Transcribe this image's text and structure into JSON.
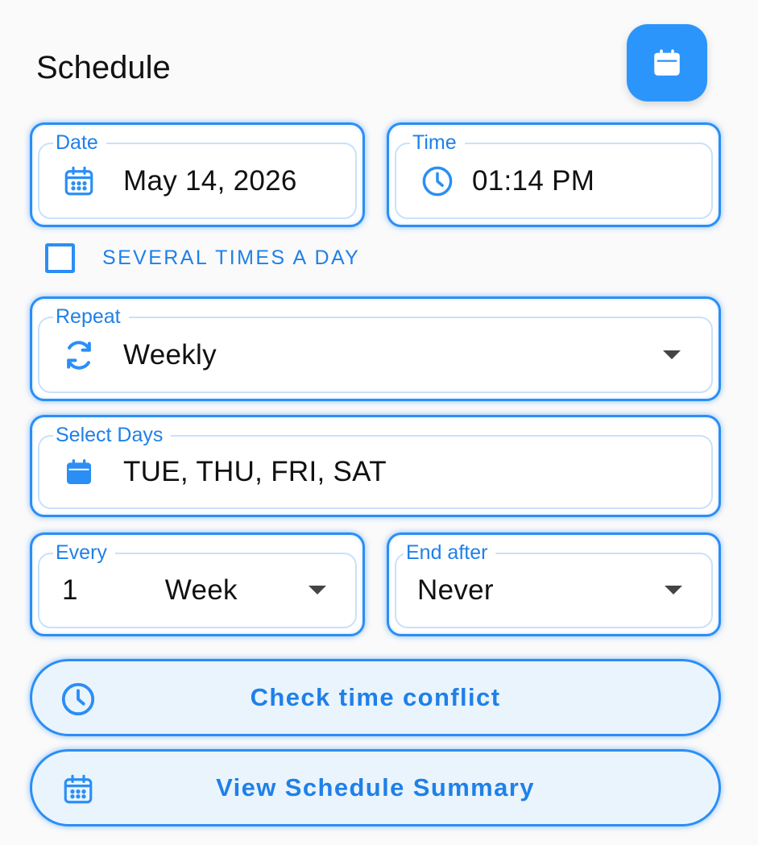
{
  "header": {
    "title": "Schedule",
    "calendar_button_icon": "calendar-icon"
  },
  "date_field": {
    "label": "Date",
    "value": "May 14, 2026",
    "icon": "calendar-grid-icon"
  },
  "time_field": {
    "label": "Time",
    "value": "01:14 PM",
    "icon": "clock-icon"
  },
  "several_times": {
    "label": "SEVERAL TIMES A DAY",
    "checked": false
  },
  "repeat_field": {
    "label": "Repeat",
    "value": "Weekly",
    "icon": "repeat-icon"
  },
  "days_field": {
    "label": "Select Days",
    "value": "TUE, THU, FRI, SAT",
    "icon": "calendar-icon"
  },
  "every_field": {
    "label": "Every",
    "number": "1",
    "unit": "Week"
  },
  "end_field": {
    "label": "End after",
    "value": "Never"
  },
  "buttons": {
    "check_conflict": "Check time conflict",
    "view_summary": "View Schedule Summary"
  },
  "colors": {
    "accent": "#2b8ef5",
    "accent_text": "#1f80e8",
    "fab": "#2b95fb"
  }
}
